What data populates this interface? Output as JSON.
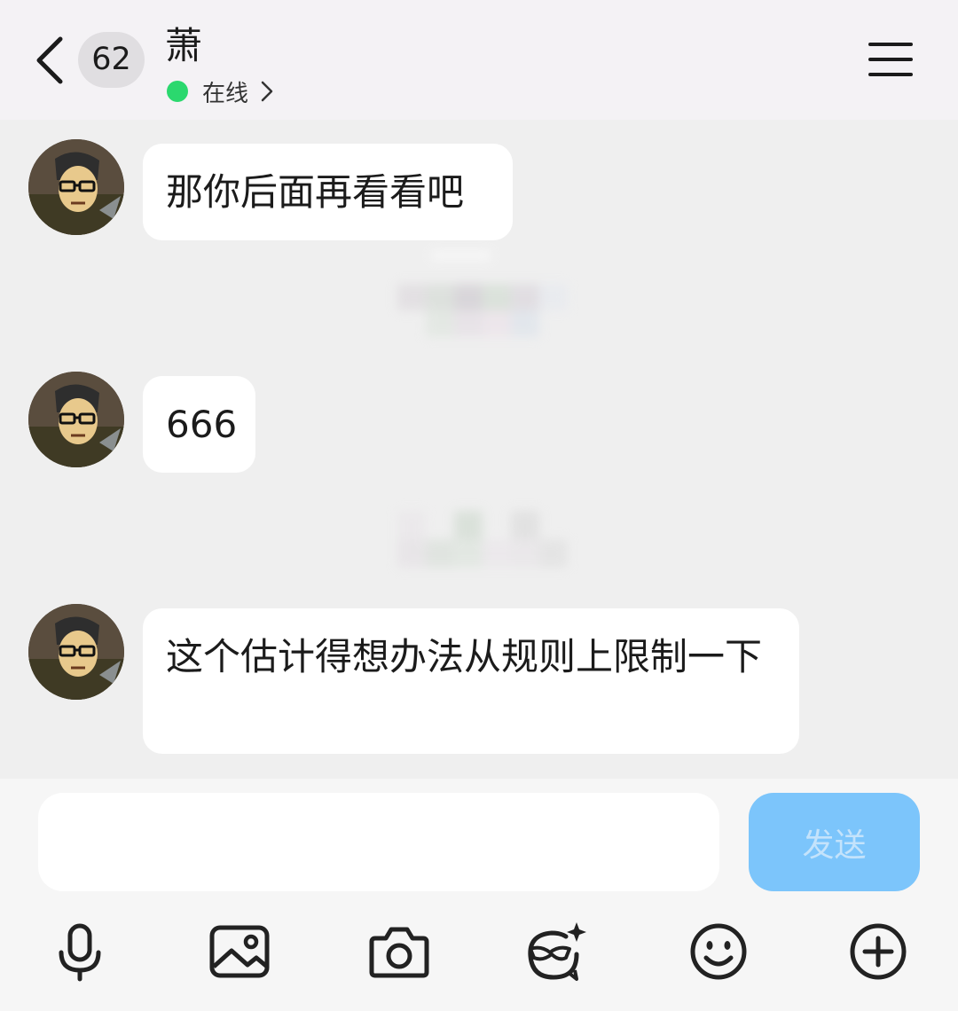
{
  "header": {
    "unread_count": "62",
    "contact_name": "萧",
    "status_text": "在线"
  },
  "messages": [
    {
      "text": "那你后面再看看吧"
    },
    {
      "text": "666"
    },
    {
      "text": "这个估计得想办法从规则上限制一下"
    }
  ],
  "composer": {
    "input_value": "",
    "send_label": "发送"
  },
  "toolbar": {
    "icons": [
      "microphone-icon",
      "image-icon",
      "camera-icon",
      "sticker-icon",
      "emoji-icon",
      "plus-icon"
    ]
  },
  "colors": {
    "header_bg": "#f4f2f5",
    "chat_bg": "#efefef",
    "online_dot": "#2bd86e",
    "send_button": "#7cc5fb"
  }
}
